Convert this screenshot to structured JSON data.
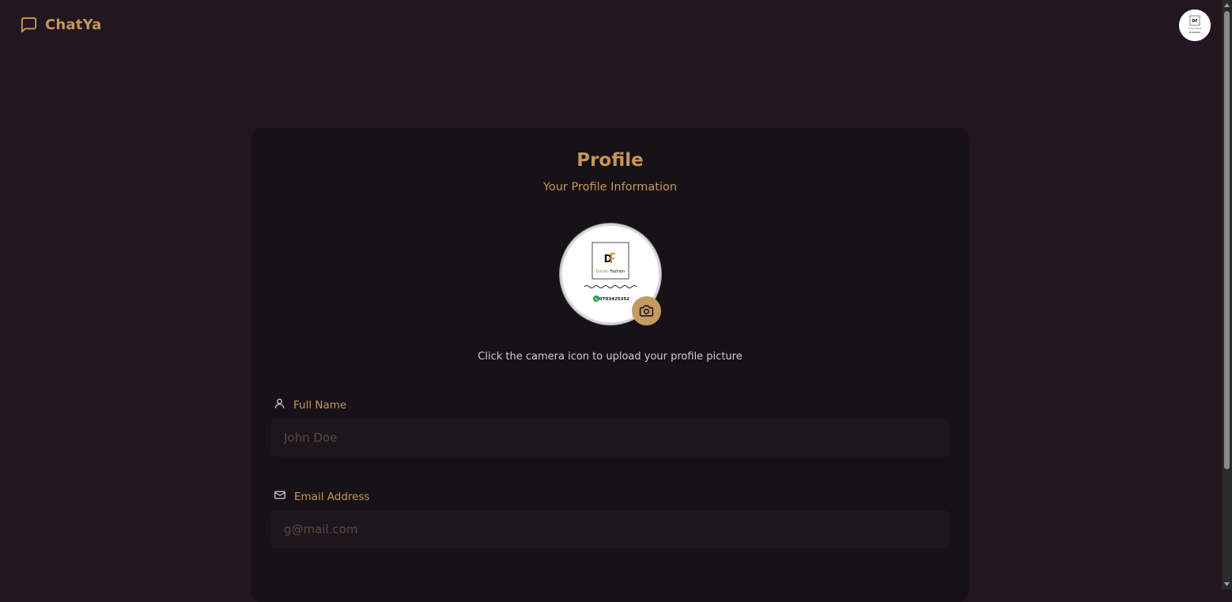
{
  "app": {
    "name": "ChatYa",
    "logo_icon": "message-square-icon"
  },
  "header": {
    "avatar_icon": "user-avatar-image"
  },
  "profile": {
    "title": "Profile",
    "subtitle": "Your Profile Information",
    "upload_hint": "Click the camera icon to upload your profile picture",
    "camera_icon": "camera-icon",
    "avatar_logo": {
      "brand": "Daniel Fashion",
      "tagline": "..........",
      "phone": "0703425352"
    }
  },
  "form": {
    "full_name": {
      "label": "Full Name",
      "icon": "user-icon",
      "placeholder": "John Doe",
      "value": ""
    },
    "email": {
      "label": "Email Address",
      "icon": "mail-icon",
      "placeholder": "g@mail.com",
      "value": ""
    }
  },
  "colors": {
    "background": "#211720",
    "card": "#171217",
    "accent": "#c8955a",
    "input_bg": "#1d161c"
  }
}
